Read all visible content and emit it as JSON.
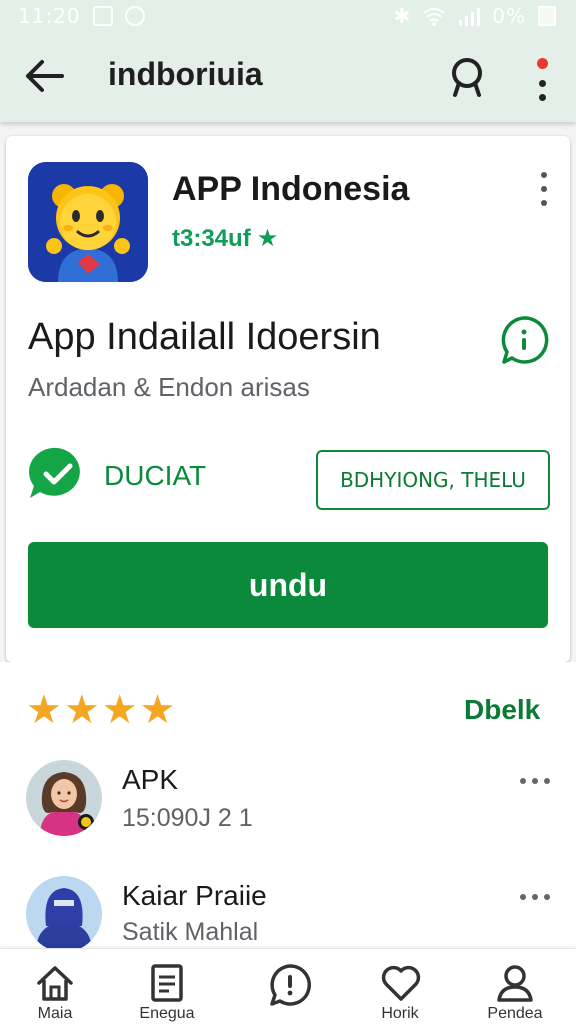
{
  "status_bar": {
    "time": "11:20",
    "battery": "0%"
  },
  "header": {
    "title": "indboriuia"
  },
  "app": {
    "name": "APP Indonesia",
    "meta": "t3:34uf",
    "long_title": "App Indailall Idoersin",
    "developer": "Ardadan & Endon arisas",
    "verified_label": "DUCIAT",
    "secondary_button": "BDHYIONG, THELU",
    "install_button": "undu"
  },
  "reviews": {
    "see_all": "Dbelk",
    "stars": 4,
    "items": [
      {
        "name": "APK",
        "sub": "15:090J 2 1"
      },
      {
        "name": "Kaiar Praiie",
        "sub": "Satik Mahlal"
      }
    ]
  },
  "bottom_nav": {
    "items": [
      {
        "label": "Maia",
        "icon": "home-icon"
      },
      {
        "label": "Enegua",
        "icon": "document-icon"
      },
      {
        "label": "",
        "icon": "chat-icon"
      },
      {
        "label": "Horik",
        "icon": "heart-icon"
      },
      {
        "label": "Pendea",
        "icon": "person-icon"
      }
    ]
  },
  "colors": {
    "accent": "#0c8a3c",
    "header_bg": "#e5efe9",
    "star": "#f5a623"
  }
}
